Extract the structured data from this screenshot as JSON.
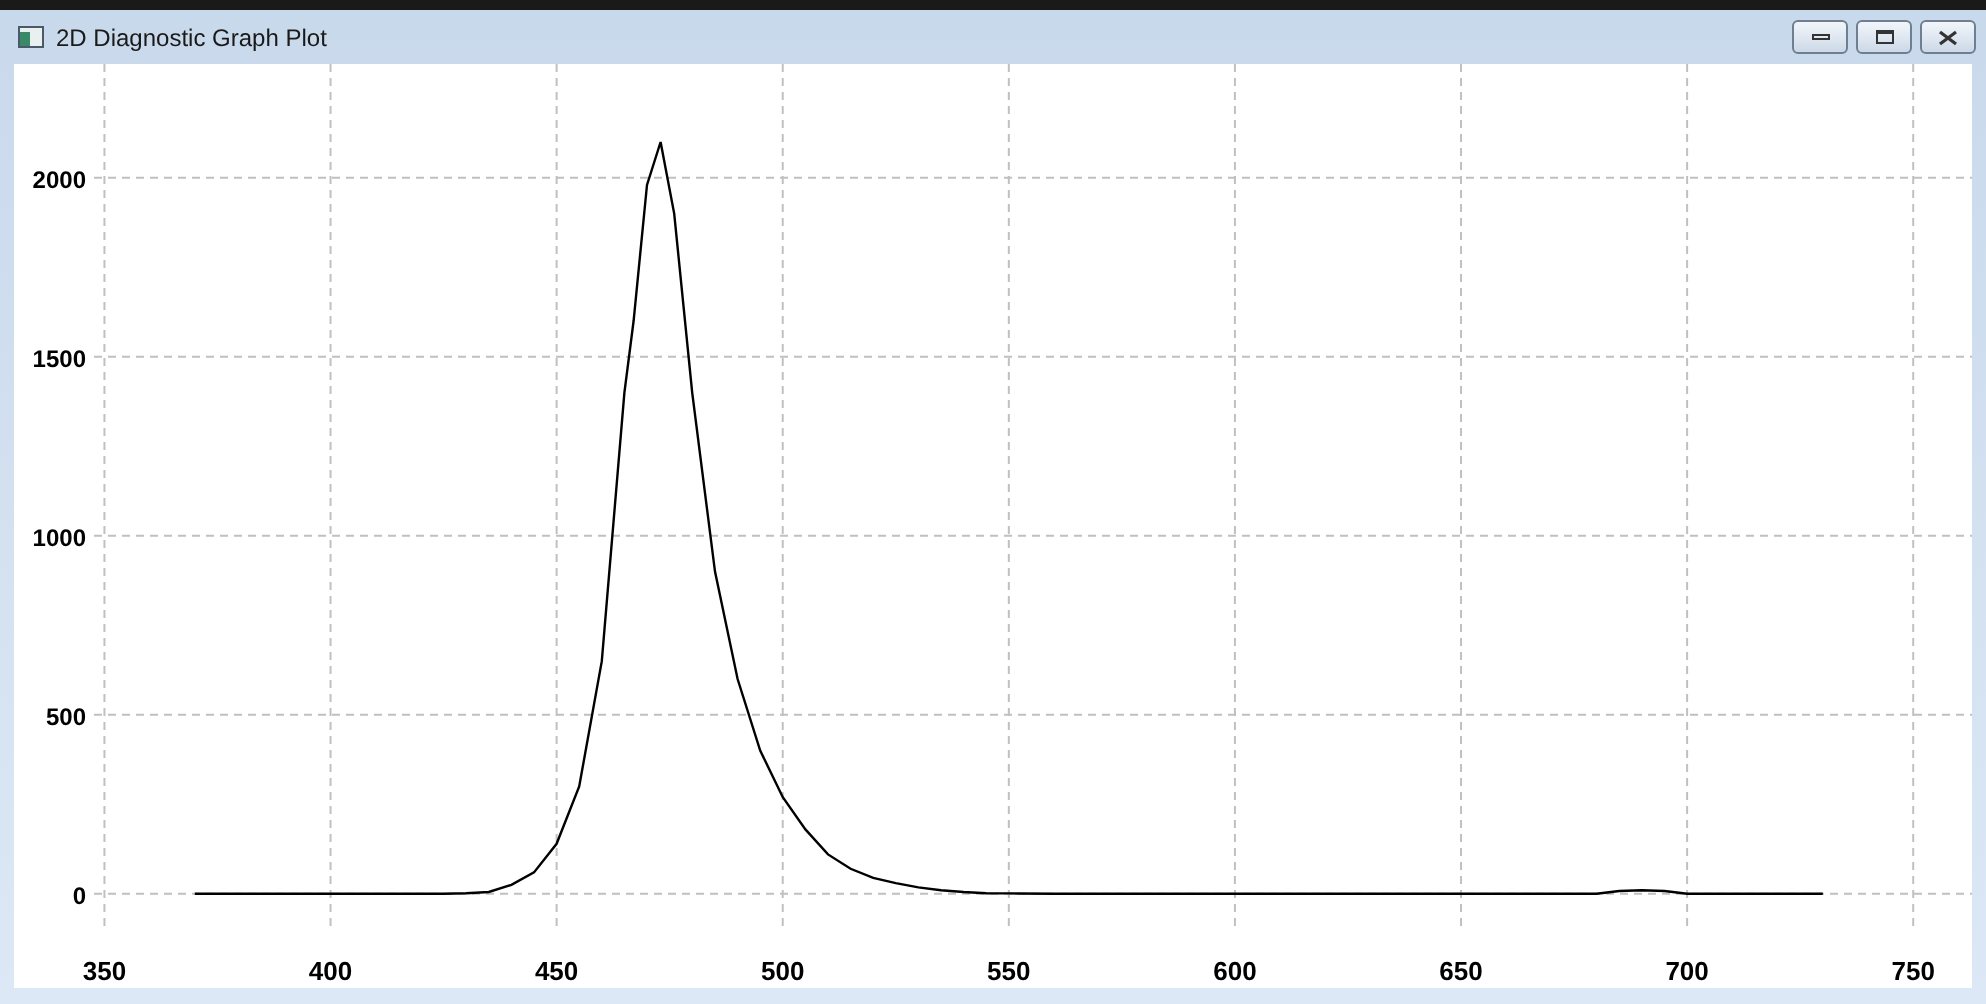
{
  "window": {
    "title": "2D Diagnostic Graph Plot"
  },
  "chart_data": {
    "type": "line",
    "grid": true,
    "xlim": [
      330,
      763
    ],
    "ylim": [
      -263,
      2318
    ],
    "xticks": [
      350,
      400,
      450,
      500,
      550,
      600,
      650,
      700,
      750
    ],
    "yticks": [
      0,
      500,
      1000,
      1500,
      2000
    ],
    "x": [
      370,
      375,
      380,
      385,
      390,
      395,
      400,
      405,
      410,
      415,
      420,
      425,
      430,
      435,
      440,
      445,
      450,
      455,
      460,
      465,
      467,
      470,
      473,
      476,
      480,
      485,
      490,
      495,
      500,
      505,
      510,
      515,
      520,
      525,
      530,
      535,
      540,
      545,
      550,
      560,
      570,
      580,
      590,
      600,
      610,
      620,
      630,
      640,
      650,
      660,
      670,
      680,
      685,
      690,
      695,
      700,
      710,
      720,
      730
    ],
    "series": [
      {
        "color": "#000000",
        "values": [
          0,
          0,
          0,
          0,
          0,
          0,
          0,
          0,
          0,
          0,
          0,
          0,
          2,
          5,
          25,
          60,
          140,
          300,
          650,
          1400,
          1600,
          1980,
          2100,
          1900,
          1400,
          900,
          600,
          400,
          270,
          180,
          110,
          70,
          45,
          30,
          18,
          10,
          5,
          2,
          1,
          0,
          0,
          0,
          0,
          0,
          0,
          0,
          0,
          0,
          0,
          0,
          0,
          0,
          8,
          10,
          8,
          0,
          0,
          0,
          0
        ]
      }
    ]
  }
}
